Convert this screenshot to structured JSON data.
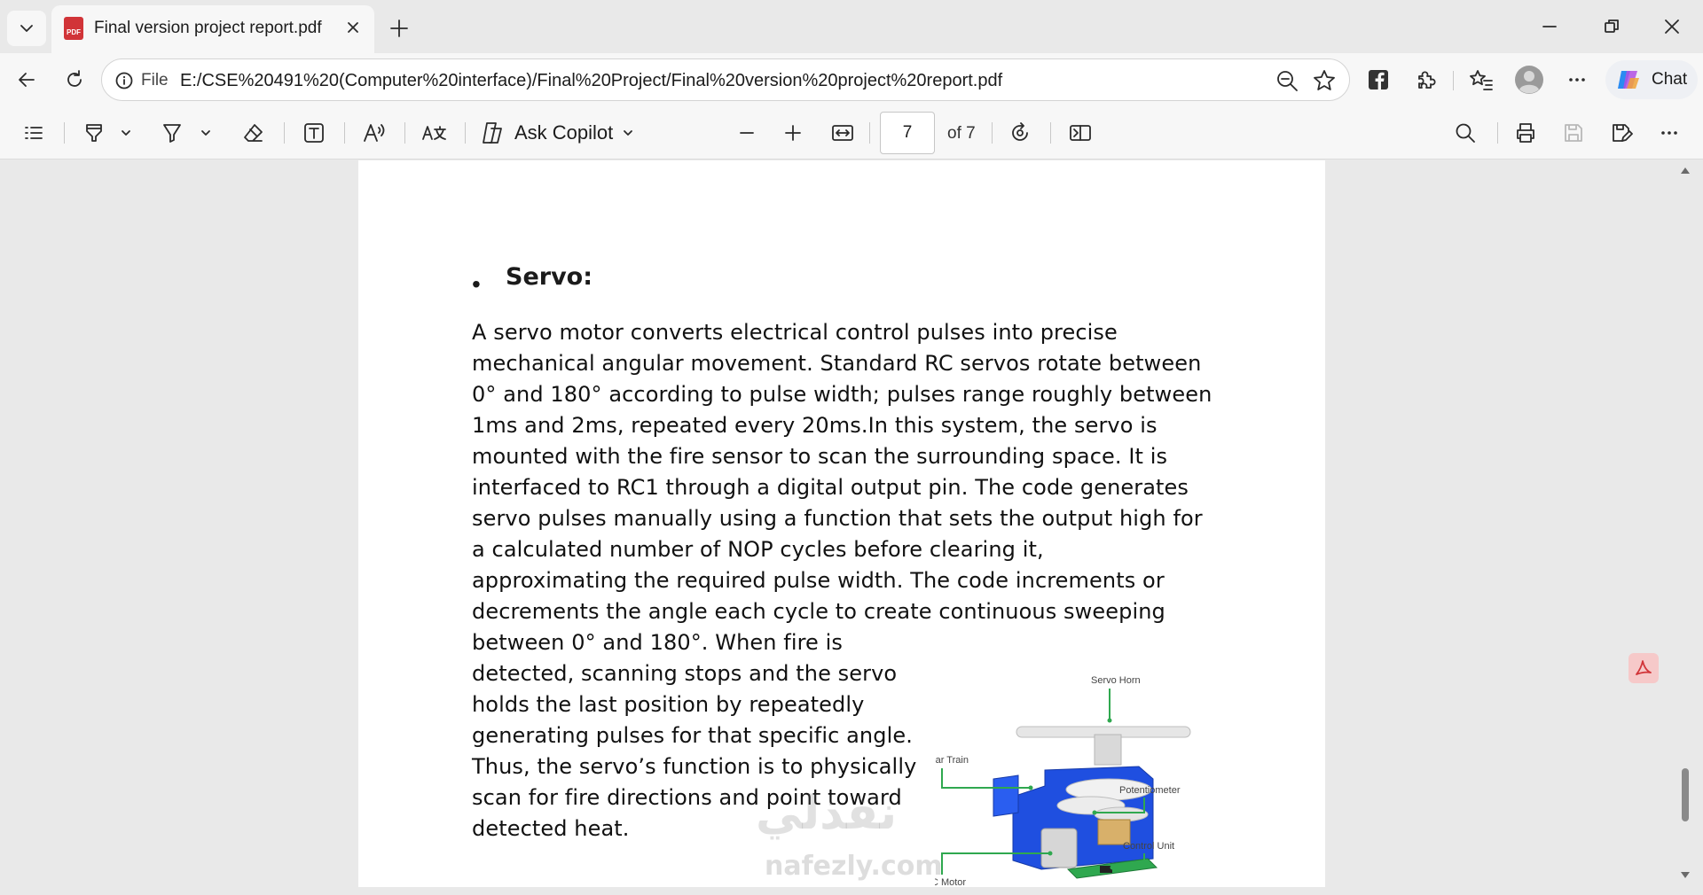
{
  "browser": {
    "tab_title": "Final version project report.pdf",
    "tab_icon_text": "PDF",
    "address_scheme": "File",
    "url": "E:/CSE%20491%20(Computer%20interface)/Final%20Project/Final%20version%20project%20report.pdf",
    "chat_label": "Chat"
  },
  "pdf_toolbar": {
    "ask_copilot_label": "Ask Copilot",
    "current_page": "7",
    "page_of": "of 7"
  },
  "document": {
    "heading": "Servo:",
    "bullet": "•",
    "paragraph_lines": [
      "A servo motor converts electrical control pulses into precise",
      "mechanical angular movement. Standard RC servos rotate between",
      "0° and 180° according to pulse width; pulses range roughly between",
      "1ms and 2ms, repeated every 20ms.In this system, the servo is",
      "mounted with the fire sensor to scan the surrounding space. It is",
      "interfaced to RC1 through a digital output pin. The code generates",
      "servo pulses manually using a function that sets the output high for",
      "a calculated number of NOP cycles before clearing it,",
      "approximating the required pulse width. The code increments or",
      "decrements the angle each cycle to create continuous sweeping",
      "between 0° and 180°. When fire is",
      "detected, scanning stops and the servo",
      "holds the last position by repeatedly",
      "generating pulses for that specific angle.",
      "Thus, the servo’s function is to physically",
      "scan for fire directions and point toward",
      "detected heat."
    ],
    "figure_labels": {
      "servo_horn": "Servo Horn",
      "gear_train": "Gear Train",
      "potentiometer": "Potentiometer",
      "control_unit": "Control Unit",
      "dc_motor": "DC Motor"
    }
  },
  "watermark": {
    "arabic": "نفذلي",
    "latin": "nafezly.com"
  },
  "colors": {
    "servo_body": "#1f4fe0",
    "pcb": "#2fa84f",
    "callout": "#2fa84f"
  }
}
